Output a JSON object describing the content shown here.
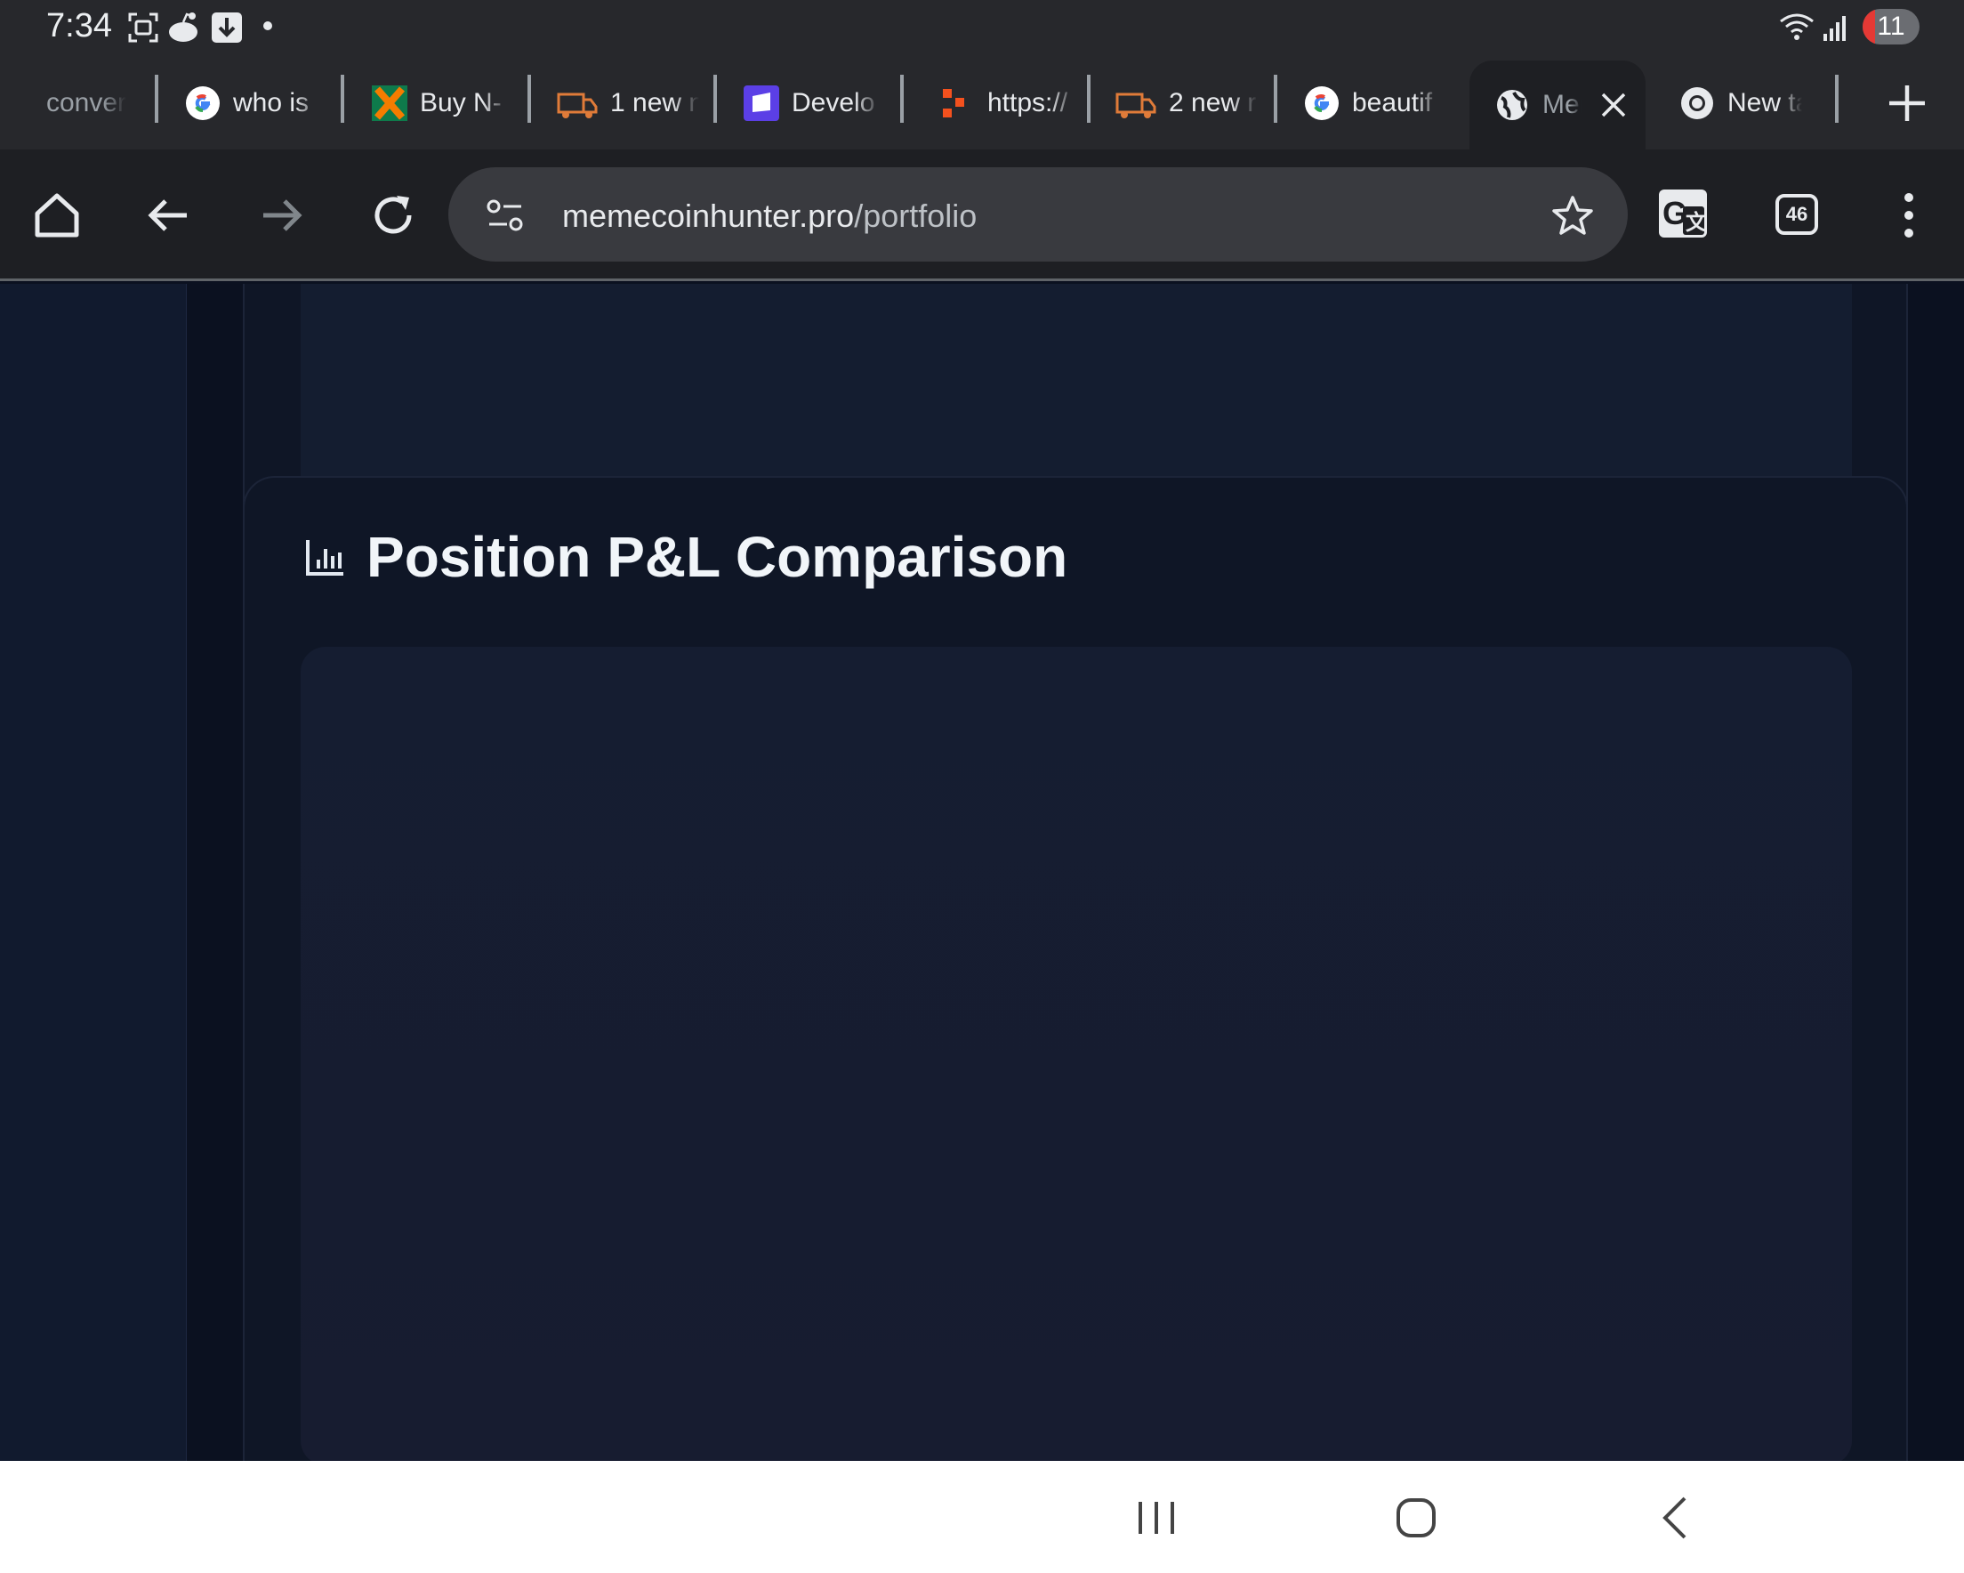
{
  "status_bar": {
    "time": "7:34",
    "battery_level": "11",
    "icons": [
      "screenshot-icon",
      "reddit-icon",
      "download-icon",
      "wifi-icon",
      "signal-icon"
    ]
  },
  "tabs": [
    {
      "label": "conver",
      "favicon": "none",
      "active": false
    },
    {
      "label": "who is",
      "favicon": "google-icon",
      "active": false
    },
    {
      "label": "Buy N-",
      "favicon": "x-logo-icon",
      "active": false
    },
    {
      "label": "1 new n",
      "favicon": "truck-icon",
      "active": false
    },
    {
      "label": "Develo",
      "favicon": "purple-app-icon",
      "active": false
    },
    {
      "label": "https://",
      "favicon": "orange-dots-icon",
      "active": false
    },
    {
      "label": "2 new r",
      "favicon": "truck-icon",
      "active": false
    },
    {
      "label": "beautif",
      "favicon": "google-icon",
      "active": false
    },
    {
      "label": "Mer",
      "favicon": "globe-icon",
      "active": true
    },
    {
      "label": "New ta",
      "favicon": "chrome-icon",
      "active": false
    }
  ],
  "toolbar": {
    "url_domain": "memecoinhunter.pro",
    "url_path": "/portfolio",
    "tab_count": "46"
  },
  "page": {
    "card_title": "Position P&L Comparison",
    "title_icon": "bar-chart-icon"
  },
  "colors": {
    "page_bg": "#0b1120",
    "card_bg": "#0f1626",
    "chart_bg": "#151d31",
    "sidebar_bg": "#111a2e",
    "browser_bg": "#1e1f23"
  }
}
